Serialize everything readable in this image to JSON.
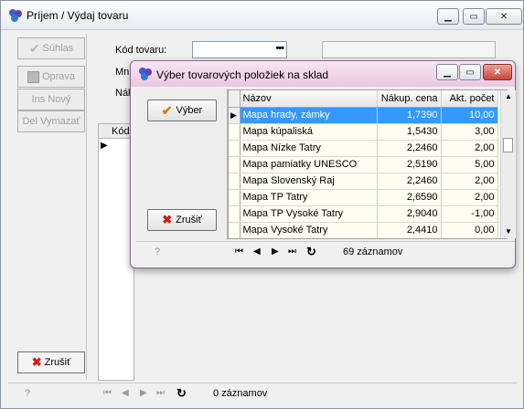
{
  "main": {
    "title": "Príjem / Výdaj tovaru",
    "buttons": {
      "suhlas": "Súhlas",
      "oprava": "Oprava",
      "ins_novy": "Ins Nový",
      "del_vymazat": "Del Vymazať",
      "zrusit": "Zrušiť"
    },
    "form": {
      "kod_tovaru_label": "Kód tovaru:",
      "mn_label_partial": "Mn",
      "nak_label_partial": "Nák",
      "kod_column_partial": "Kód"
    },
    "status": {
      "help": "?",
      "count": "0 záznamov"
    }
  },
  "dialog": {
    "title": "Výber tovarových položiek na sklad",
    "buttons": {
      "vyber": "Výber",
      "zrusit": "Zrušiť"
    },
    "table": {
      "columns": [
        "Názov",
        "Nákup. cena",
        "Akt. počet"
      ],
      "rows": [
        [
          "Mapa hrady, zámky",
          "1,7390",
          "10,00"
        ],
        [
          "Mapa kúpaliská",
          "1,5430",
          "3,00"
        ],
        [
          "Mapa Nízke Tatry",
          "2,2460",
          "2,00"
        ],
        [
          "Mapa pamiatky UNESCO",
          "2,5190",
          "5,00"
        ],
        [
          "Mapa Slovenský Raj",
          "2,2460",
          "2,00"
        ],
        [
          "Mapa TP Tatry",
          "2,6590",
          "2,00"
        ],
        [
          "Mapa TP Vysoké Tatry",
          "2,9040",
          "-1,00"
        ],
        [
          "Mapa Vysoké Tatry",
          "2,4410",
          "0,00"
        ]
      ],
      "selected_row": 0
    },
    "status": {
      "help": "?",
      "count": "69 záznamov"
    }
  },
  "colors": {
    "selection": "#3399ff",
    "row_background": "#fffdf0",
    "dialog_titlebar": "#e9c6e2"
  },
  "icons": [
    "app-icon",
    "minimize-icon",
    "maximize-icon",
    "close-icon",
    "checkmark-icon",
    "edit-icon",
    "x-icon",
    "first-record-icon",
    "prev-record-icon",
    "next-record-icon",
    "last-record-icon",
    "refresh-icon",
    "help-icon",
    "row-pointer-icon",
    "ellipsis-icon"
  ]
}
